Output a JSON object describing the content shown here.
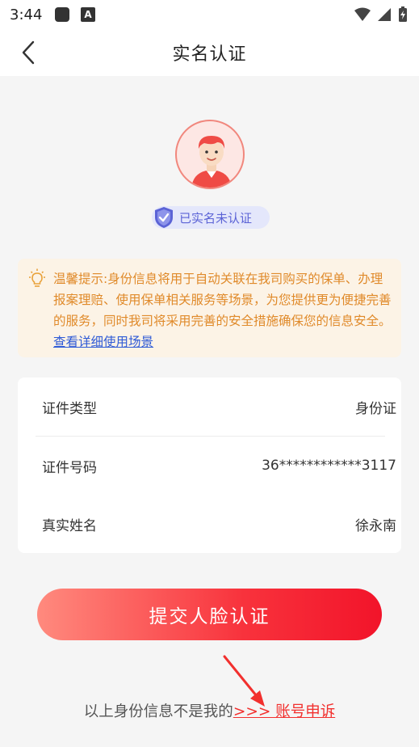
{
  "status_bar": {
    "time": "3:44"
  },
  "nav": {
    "title": "实名认证"
  },
  "verify_badge": {
    "text": "已实名未认证"
  },
  "tip": {
    "text": "温馨提示:身份信息将用于自动关联在我司购买的保单、办理报案理赔、使用保单相关服务等场景，为您提供更为便捷完善的服务，同时我司将采用完善的安全措施确保您的信息安全。",
    "link": "查看详细使用场景"
  },
  "info": {
    "rows": [
      {
        "label": "证件类型",
        "value": "身份证"
      },
      {
        "label": "证件号码",
        "value": "36************3117"
      },
      {
        "label": "真实姓名",
        "value": "徐永南"
      }
    ]
  },
  "submit_label": "提交人脸认证",
  "appeal": {
    "prefix": "以上身份信息不是我的",
    "link": ">>> 账号申诉"
  },
  "colors": {
    "accent_red": "#f8323c",
    "tip_orange": "#e08a2a",
    "badge_blue": "#5b63d6"
  }
}
